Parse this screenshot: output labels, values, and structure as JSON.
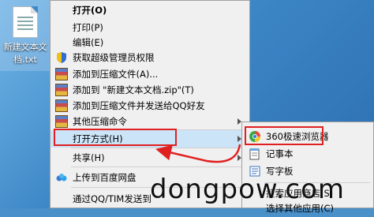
{
  "desktop": {
    "file_name_line1": "新建文本文",
    "file_name_line2": "档.txt"
  },
  "menu": {
    "items": [
      {
        "label": "打开(O)"
      },
      {
        "label": "打印(P)"
      },
      {
        "label": "编辑(E)"
      },
      {
        "label": "获取超级管理员权限"
      },
      {
        "label": "添加到压缩文件(A)..."
      },
      {
        "label": "添加到 \"新建文本文档.zip\"(T)"
      },
      {
        "label": "添加到压缩文件并发送给QQ好友"
      },
      {
        "label": "其他压缩命令"
      },
      {
        "label": "打开方式(H)"
      },
      {
        "label": "共享(H)"
      },
      {
        "label": "上传到百度网盘"
      },
      {
        "label": "通过QQ/TIM发送到"
      }
    ]
  },
  "submenu": {
    "items": [
      {
        "label": "360极速浏览器"
      },
      {
        "label": "记事本"
      },
      {
        "label": "写字板"
      },
      {
        "label": "搜索应用商店(S)"
      },
      {
        "label": "选择其他应用(C)"
      }
    ]
  },
  "watermark": "dongpow.com",
  "colors": {
    "highlight_box": "#e02020",
    "menu_bg": "#f0f0f0"
  }
}
